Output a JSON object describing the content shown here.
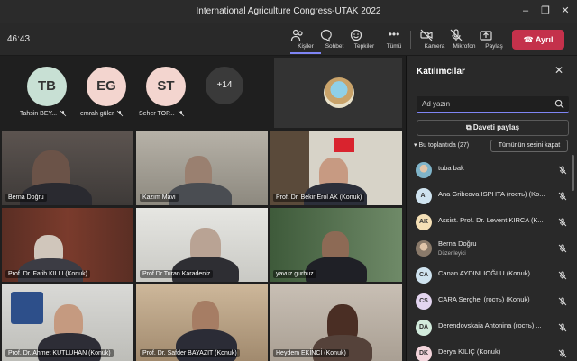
{
  "window": {
    "title": "International Agriculture Congress-UTAK 2022"
  },
  "toolbar": {
    "timer": "46:43",
    "people_label": "Kişiler",
    "chat_label": "Sohbet",
    "reactions_label": "Tepkiler",
    "more_label": "Tümü",
    "camera_label": "Kamera",
    "mic_label": "Mikrofon",
    "share_label": "Paylaş",
    "leave_label": "Ayrıl"
  },
  "avatars": [
    {
      "initials": "TB",
      "name": "Tahsin BEY...",
      "color": "#c8e0d4"
    },
    {
      "initials": "EG",
      "name": "emrah güler",
      "color": "#f3d5cf"
    },
    {
      "initials": "ST",
      "name": "Seher TOP...",
      "color": "#f3d5cf"
    }
  ],
  "overflow_count": "+14",
  "tiles": [
    {
      "name": "Berna Doğru"
    },
    {
      "name": "Kazım Mavi"
    },
    {
      "name": "Prof. Dr. Bekir Erol AK (Konuk)"
    },
    {
      "name": "Prof. Dr. Fatih KILLI (Konuk)"
    },
    {
      "name": "Prof.Dr.Turan Karadeniz"
    },
    {
      "name": "yavuz gurbuz"
    },
    {
      "name": "Prof. Dr. Ahmet KUTLUHAN (Konuk)"
    },
    {
      "name": "Prof. Dr. Safder BAYAZIT (Konuk)"
    },
    {
      "name": "Heydem EKİNCİ (Konuk)"
    }
  ],
  "panel": {
    "title": "Katılımcılar",
    "search_placeholder": "Ad yazın",
    "invite_label": "Daveti paylaş",
    "section_label": "Bu toplantıda (27)",
    "mute_all_label": "Tümünün sesini kapat",
    "participants": [
      {
        "initials": "",
        "name": "tuba bak",
        "role": "",
        "color": "#7fb4c9",
        "photo": true
      },
      {
        "initials": "AI",
        "name": "Ana Gribcova ISPHTA (гость) (Ko...",
        "role": "",
        "color": "#cfe3ef"
      },
      {
        "initials": "AK",
        "name": "Assist. Prof. Dr. Levent KIRCA (K...",
        "role": "",
        "color": "#f4dfb5"
      },
      {
        "initials": "",
        "name": "Berna Doğru",
        "role": "Düzenleyici",
        "color": "#8a7a6a",
        "photo": true
      },
      {
        "initials": "CA",
        "name": "Canan AYDINLIOĞLU (Konuk)",
        "role": "",
        "color": "#cfe3ef"
      },
      {
        "initials": "CS",
        "name": "CARA Serghei (гость) (Konuk)",
        "role": "",
        "color": "#e3d5f0"
      },
      {
        "initials": "DA",
        "name": "Derendovskaia Antonina (гость) ...",
        "role": "",
        "color": "#d2ebdc"
      },
      {
        "initials": "DK",
        "name": "Derya KILIÇ (Konuk)",
        "role": "",
        "color": "#f3d5dc"
      }
    ]
  }
}
